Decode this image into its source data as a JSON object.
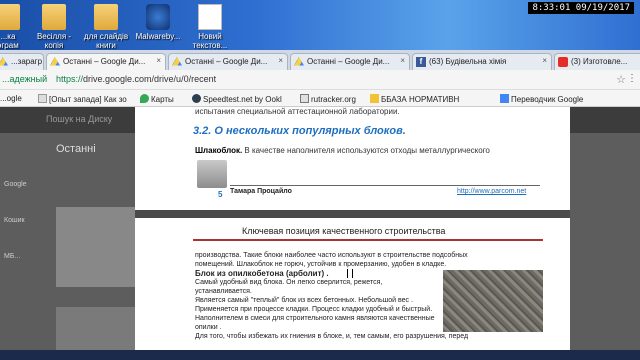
{
  "desktop": {
    "icons": [
      {
        "label": "...ка\nэграм",
        "kind": "folder"
      },
      {
        "label": "Весілля -\nкопія",
        "kind": "folder"
      },
      {
        "label": "для слайдів\nкниги",
        "kind": "folder"
      },
      {
        "label": "Malwareby...",
        "kind": "mwb"
      },
      {
        "label": "Новий\nтекстов...",
        "kind": "doc"
      }
    ],
    "clock": "8:33:01  09/19/2017"
  },
  "browser": {
    "tabs": [
      {
        "label": "...зарагр",
        "icon": "drive",
        "active": false
      },
      {
        "label": "Останні – Google Ди...",
        "icon": "drive",
        "active": true
      },
      {
        "label": "Останні – Google Ди...",
        "icon": "drive",
        "active": false
      },
      {
        "label": "Останні – Google Ди...",
        "icon": "drive",
        "active": false
      },
      {
        "label": "(63) Будівельна хімія",
        "icon": "fb",
        "active": false
      },
      {
        "label": "(3) Изготовле...",
        "icon": "yt",
        "active": false
      }
    ],
    "secure_label": "...адежный",
    "url_scheme": "https://",
    "url_rest": "drive.google.com/drive/u/0/recent",
    "bookmarks": [
      {
        "label": "...ogle"
      },
      {
        "label": "[Опыт запада] Как зо"
      },
      {
        "label": "Карты"
      },
      {
        "label": "Speedtest.net by Ookl"
      },
      {
        "label": "rutracker.org"
      },
      {
        "label": "ББАЗА НОРМАТИВН"
      },
      {
        "label": "Переводчик Google"
      }
    ]
  },
  "drive": {
    "search_placeholder": "Пошук на Диску",
    "title": "Останні",
    "sidebar": [
      "Google",
      "Кошик",
      "МБ..."
    ]
  },
  "doc_page1": {
    "line1": "испытания специальной аттестационной лаборатории.",
    "heading": "3.2. О нескольких популярных блоков.",
    "para_bold": "Шлакоблок.",
    "para_rest": " В качестве наполнителя используются отходы металлургического",
    "page_num": "5",
    "author": "Тамара Процайло",
    "link": "http://www.parcom.net"
  },
  "doc_page2": {
    "header": "Ключевая позиция качественного строительства",
    "lines": [
      "производства. Такие блоки наиболее часто используют в строительстве подсобных",
      "помещений. Шлакоблок не горюч, устойчив к промерзанию, удобен в кладке."
    ],
    "bold_line": "Блок из опилкобетона (арболит) .",
    "narrow_lines": [
      "Самый удобный вид блока. Он легко сверлится, режется, устанавливается.",
      "Является самый \"теплый\" блок из всех бетонных. Небольшой вес .",
      "Применяется при процессе кладки. Процесс кладки удобный и быстрый.",
      "Наполнителем в смеси для строительного камня являются качественные опилки ."
    ],
    "last_line": "Для того, чтобы избежать их гниения в блоке, и, тем самым, его разрушения, перед"
  }
}
